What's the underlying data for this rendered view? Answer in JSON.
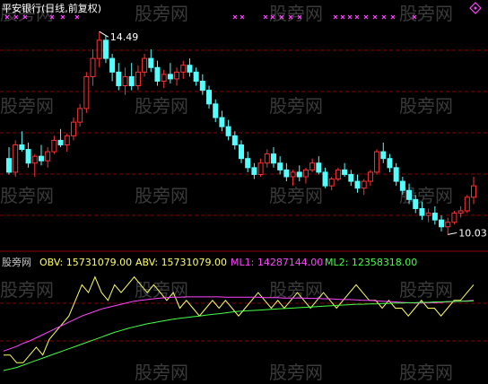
{
  "header": {
    "title": "平安银行(日线,前复权)"
  },
  "watermark": "股旁网",
  "indicator": {
    "name": "股旁网",
    "obv_label": "OBV: 15731079.00",
    "abv_label": "ABV: 15731079.00",
    "ml1_label": "ML1: 14287144.00",
    "ml2_label": "ML2: 12358318.00"
  },
  "colors": {
    "up": "#ff3232",
    "down": "#54ffff",
    "obv": "#ffff66",
    "ml1": "#ff44ff",
    "ml2": "#44ff44",
    "grid": "#8b0000",
    "text": "#c8c8c8",
    "marker": "#ff44ff"
  },
  "chart_data": [
    {
      "type": "candlestick",
      "title": "平安银行(日线,前复权)",
      "annotations": [
        {
          "text": "14.49",
          "value": 14.49,
          "kind": "high"
        },
        {
          "text": "10.03",
          "value": 10.03,
          "kind": "low"
        }
      ],
      "ylim": [
        9.9,
        14.75
      ],
      "candles": [
        [
          11.7,
          11.95,
          11.35,
          11.4
        ],
        [
          11.4,
          12.1,
          11.3,
          12.0
        ],
        [
          12.0,
          12.3,
          11.85,
          11.9
        ],
        [
          11.9,
          12.05,
          11.5,
          11.6
        ],
        [
          11.6,
          11.8,
          11.3,
          11.75
        ],
        [
          11.75,
          12.0,
          11.55,
          11.65
        ],
        [
          11.65,
          11.95,
          11.5,
          11.85
        ],
        [
          11.85,
          12.2,
          11.8,
          12.1
        ],
        [
          12.1,
          12.35,
          11.95,
          12.0
        ],
        [
          12.0,
          12.25,
          11.85,
          12.2
        ],
        [
          12.2,
          12.6,
          12.1,
          12.5
        ],
        [
          12.5,
          12.9,
          12.4,
          12.8
        ],
        [
          12.8,
          13.6,
          12.7,
          13.5
        ],
        [
          13.5,
          14.1,
          13.3,
          13.9
        ],
        [
          13.9,
          14.49,
          13.7,
          14.3
        ],
        [
          14.3,
          14.4,
          13.8,
          13.9
        ],
        [
          13.9,
          14.0,
          13.4,
          13.6
        ],
        [
          13.6,
          13.8,
          13.2,
          13.3
        ],
        [
          13.3,
          13.7,
          13.1,
          13.5
        ],
        [
          13.5,
          13.8,
          13.2,
          13.3
        ],
        [
          13.3,
          13.75,
          13.2,
          13.6
        ],
        [
          13.6,
          14.0,
          13.5,
          13.9
        ],
        [
          13.9,
          14.1,
          13.6,
          13.7
        ],
        [
          13.7,
          13.85,
          13.3,
          13.4
        ],
        [
          13.4,
          13.65,
          13.25,
          13.55
        ],
        [
          13.55,
          13.8,
          13.35,
          13.45
        ],
        [
          13.45,
          13.7,
          13.3,
          13.6
        ],
        [
          13.6,
          13.85,
          13.45,
          13.75
        ],
        [
          13.75,
          13.9,
          13.5,
          13.6
        ],
        [
          13.6,
          13.7,
          13.3,
          13.4
        ],
        [
          13.4,
          13.55,
          13.1,
          13.2
        ],
        [
          13.2,
          13.3,
          12.8,
          12.9
        ],
        [
          12.9,
          13.0,
          12.5,
          12.6
        ],
        [
          12.6,
          12.75,
          12.3,
          12.4
        ],
        [
          12.4,
          12.55,
          12.1,
          12.2
        ],
        [
          12.2,
          12.3,
          11.9,
          12.0
        ],
        [
          12.0,
          12.1,
          11.6,
          11.7
        ],
        [
          11.7,
          11.85,
          11.4,
          11.5
        ],
        [
          11.5,
          11.6,
          11.25,
          11.35
        ],
        [
          11.35,
          11.7,
          11.3,
          11.6
        ],
        [
          11.6,
          11.9,
          11.5,
          11.8
        ],
        [
          11.8,
          11.95,
          11.5,
          11.6
        ],
        [
          11.6,
          11.75,
          11.35,
          11.45
        ],
        [
          11.45,
          11.6,
          11.2,
          11.3
        ],
        [
          11.3,
          11.45,
          11.1,
          11.4
        ],
        [
          11.4,
          11.55,
          11.2,
          11.3
        ],
        [
          11.3,
          11.5,
          11.15,
          11.45
        ],
        [
          11.45,
          11.7,
          11.4,
          11.6
        ],
        [
          11.6,
          11.75,
          11.35,
          11.4
        ],
        [
          11.4,
          11.5,
          11.05,
          11.1
        ],
        [
          11.1,
          11.3,
          11.0,
          11.25
        ],
        [
          11.25,
          11.5,
          11.2,
          11.45
        ],
        [
          11.45,
          11.6,
          11.3,
          11.35
        ],
        [
          11.35,
          11.45,
          11.1,
          11.2
        ],
        [
          11.2,
          11.35,
          10.95,
          11.05
        ],
        [
          11.05,
          11.25,
          10.9,
          11.2
        ],
        [
          11.2,
          11.45,
          11.1,
          11.4
        ],
        [
          11.4,
          11.9,
          11.35,
          11.85
        ],
        [
          11.85,
          12.05,
          11.6,
          11.7
        ],
        [
          11.7,
          11.8,
          11.4,
          11.5
        ],
        [
          11.5,
          11.6,
          11.1,
          11.2
        ],
        [
          11.2,
          11.3,
          10.9,
          11.0
        ],
        [
          11.0,
          11.15,
          10.7,
          10.8
        ],
        [
          10.8,
          10.9,
          10.5,
          10.6
        ],
        [
          10.6,
          10.75,
          10.35,
          10.45
        ],
        [
          10.45,
          10.6,
          10.3,
          10.5
        ],
        [
          10.5,
          10.65,
          10.25,
          10.35
        ],
        [
          10.35,
          10.45,
          10.1,
          10.2
        ],
        [
          10.2,
          10.4,
          10.03,
          10.3
        ],
        [
          10.3,
          10.55,
          10.25,
          10.5
        ],
        [
          10.5,
          10.65,
          10.4,
          10.55
        ],
        [
          10.55,
          10.9,
          10.5,
          10.85
        ],
        [
          10.85,
          11.3,
          10.7,
          11.1
        ]
      ]
    },
    {
      "type": "line",
      "series": [
        {
          "name": "OBV",
          "values": [
            20,
            20,
            19,
            19,
            20,
            21,
            20,
            22,
            23,
            24,
            25,
            27,
            29,
            28,
            30,
            28,
            27,
            29,
            28,
            29,
            30,
            29,
            28,
            29,
            28,
            27,
            28,
            26,
            27,
            26,
            25,
            26,
            27,
            26,
            27,
            26,
            25,
            26,
            27,
            28,
            27,
            26,
            27,
            26,
            27,
            28,
            27,
            26,
            27,
            28,
            27,
            26,
            27,
            28,
            29,
            28,
            27,
            27,
            26,
            27,
            26,
            26,
            25,
            26,
            27,
            26,
            26,
            25,
            26,
            27,
            27,
            28,
            29
          ]
        },
        {
          "name": "ML1",
          "values": [
            20.5,
            20.8,
            21.1,
            21.5,
            21.8,
            22.2,
            22.6,
            23.0,
            23.4,
            23.8,
            24.2,
            24.6,
            25.0,
            25.3,
            25.6,
            25.9,
            26.1,
            26.3,
            26.5,
            26.7,
            26.9,
            27.0,
            27.1,
            27.2,
            27.3,
            27.35,
            27.4,
            27.4,
            27.45,
            27.45,
            27.45,
            27.45,
            27.45,
            27.45,
            27.4,
            27.4,
            27.4,
            27.4,
            27.4,
            27.4,
            27.35,
            27.35,
            27.35,
            27.3,
            27.3,
            27.3,
            27.3,
            27.25,
            27.25,
            27.2,
            27.2,
            27.15,
            27.1,
            27.1,
            27.05,
            27.0,
            27.0,
            26.95,
            26.9,
            26.85,
            26.8,
            26.75,
            26.7,
            26.65,
            26.65,
            26.7,
            26.7,
            26.75,
            26.8,
            26.85,
            26.9,
            26.95,
            27.0
          ]
        },
        {
          "name": "ML2",
          "values": [
            18.0,
            18.2,
            18.4,
            18.7,
            19.0,
            19.3,
            19.6,
            19.9,
            20.2,
            20.5,
            20.8,
            21.1,
            21.4,
            21.7,
            22.0,
            22.3,
            22.6,
            22.9,
            23.15,
            23.4,
            23.6,
            23.8,
            24.0,
            24.15,
            24.3,
            24.45,
            24.6,
            24.7,
            24.8,
            24.9,
            25.0,
            25.1,
            25.2,
            25.3,
            25.4,
            25.5,
            25.6,
            25.65,
            25.7,
            25.75,
            25.8,
            25.85,
            25.9,
            25.95,
            26.0,
            26.05,
            26.1,
            26.15,
            26.2,
            26.25,
            26.3,
            26.35,
            26.4,
            26.45,
            26.5,
            26.5,
            26.55,
            26.55,
            26.6,
            26.6,
            26.65,
            26.65,
            26.7,
            26.7,
            26.75,
            26.75,
            26.8,
            26.8,
            26.85,
            26.85,
            26.9,
            26.9,
            26.95
          ]
        }
      ],
      "ylim": [
        17.2,
        31
      ]
    }
  ]
}
